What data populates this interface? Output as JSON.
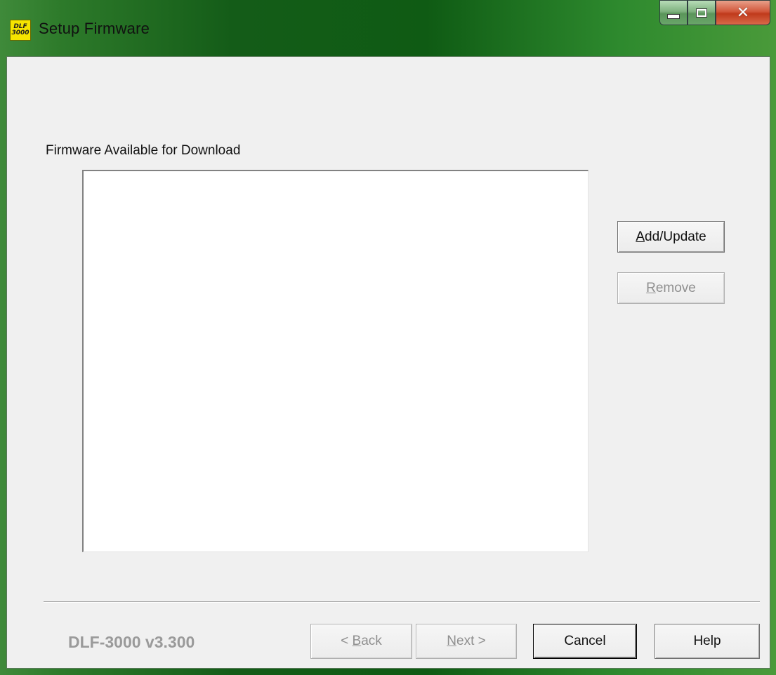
{
  "window": {
    "title": "Setup Firmware",
    "icon_text": "DLF 3000",
    "controls": {
      "minimize_icon": "minimize-icon",
      "maximize_icon": "maximize-icon",
      "close_icon": "close-icon"
    }
  },
  "firmware": {
    "section_label": "Firmware Available for Download",
    "items": [],
    "add_update": {
      "mnemonic": "A",
      "rest": "dd/Update",
      "enabled": true
    },
    "remove": {
      "mnemonic": "R",
      "rest": "emove",
      "enabled": false
    }
  },
  "footer": {
    "version": "DLF-3000 v3.300",
    "back": {
      "prefix": "< ",
      "mnemonic": "B",
      "rest": "ack",
      "enabled": false
    },
    "next": {
      "mnemonic": "N",
      "rest": "ext >",
      "enabled": false
    },
    "cancel": {
      "label": "Cancel",
      "enabled": true
    },
    "help": {
      "label": "Help",
      "enabled": true
    }
  },
  "colors": {
    "titlebar_accent": "#145c18",
    "dialog_bg": "#f0f0f0",
    "disabled_text": "#8f8f8f",
    "close_button": "#c03a1c"
  }
}
